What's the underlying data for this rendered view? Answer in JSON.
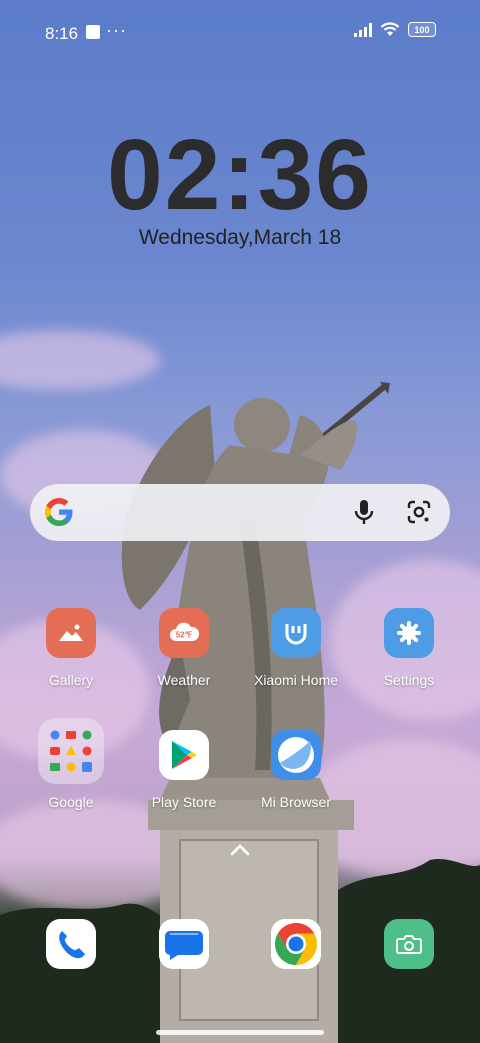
{
  "status_bar": {
    "time": "8:16",
    "more_indicator": "···",
    "battery": "100",
    "icons": [
      "signal-icon",
      "wifi-icon",
      "battery-icon"
    ]
  },
  "clock": {
    "time": "02:36",
    "date": "Wednesday,March 18"
  },
  "search_bar": {
    "icons": [
      "google-g-icon",
      "microphone-icon",
      "google-lens-icon"
    ]
  },
  "apps": {
    "row1": [
      {
        "label": "Gallery",
        "icon": "gallery-icon",
        "color": "#e36e55"
      },
      {
        "label": "Weather",
        "icon": "weather-icon",
        "color": "#e36e55",
        "icon_text": "52℉"
      },
      {
        "label": "Xiaomi Home",
        "icon": "xiaomi-home-icon",
        "color": "#4f9ce6"
      },
      {
        "label": "Settings",
        "icon": "settings-gear-icon",
        "color": "#4f9ce6"
      }
    ],
    "row2": [
      {
        "label": "Google",
        "icon": "google-folder-icon"
      },
      {
        "label": "Play Store",
        "icon": "play-store-icon"
      },
      {
        "label": "Mi Browser",
        "icon": "mi-browser-icon",
        "color": "#3f8ee8"
      }
    ]
  },
  "dock": [
    {
      "icon": "phone-icon",
      "color": "#ffffff"
    },
    {
      "icon": "messages-icon",
      "color": "#ffffff"
    },
    {
      "icon": "chrome-icon",
      "color": "#ffffff"
    },
    {
      "icon": "camera-icon",
      "color": "#4fbf8a"
    }
  ],
  "colors": {
    "clock_text": "#2c2c2e",
    "label_text": "#ffffff",
    "search_bg": "#f0f0f4"
  }
}
